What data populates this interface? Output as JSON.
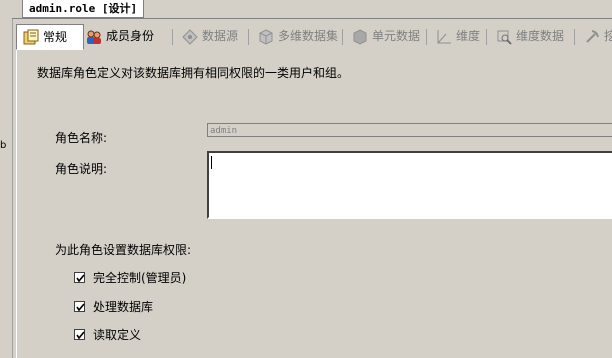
{
  "document_tab": {
    "title": "admin.role [设计]"
  },
  "left_fragment": "b",
  "tabs": [
    {
      "label": "常规",
      "icon": "general-icon",
      "state": "active"
    },
    {
      "label": "成员身份",
      "icon": "members-icon",
      "state": "enabled"
    },
    {
      "label": "数据源",
      "icon": "datasource-icon",
      "state": "disabled"
    },
    {
      "label": "多维数据集",
      "icon": "cube-icon",
      "state": "disabled"
    },
    {
      "label": "单元数据",
      "icon": "cell-data-icon",
      "state": "disabled"
    },
    {
      "label": "维度",
      "icon": "dimension-icon",
      "state": "disabled"
    },
    {
      "label": "维度数据",
      "icon": "dimension-data-icon",
      "state": "disabled"
    },
    {
      "label": "挖掘结",
      "icon": "mining-icon",
      "state": "disabled"
    }
  ],
  "general": {
    "description": "数据库角色定义对该数据库拥有相同权限的一类用户和组。",
    "role_name_label": "角色名称:",
    "role_name_value": "admin",
    "role_description_label": "角色说明:",
    "role_description_value": "",
    "permissions_label": "为此角色设置数据库权限:",
    "permissions": [
      {
        "label": "完全控制(管理员)",
        "checked": true
      },
      {
        "label": "处理数据库",
        "checked": true
      },
      {
        "label": "读取定义",
        "checked": true
      }
    ]
  }
}
